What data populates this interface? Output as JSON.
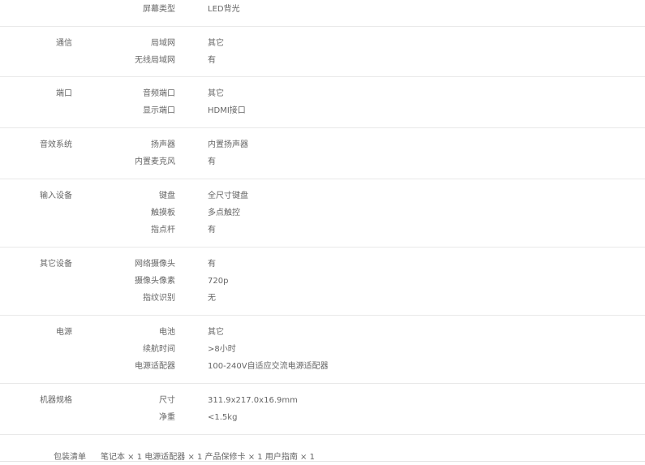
{
  "groups": [
    {
      "label": "",
      "rows": [
        {
          "k": "屏幕类型",
          "v": "LED背光"
        }
      ]
    },
    {
      "label": "通信",
      "rows": [
        {
          "k": "局域网",
          "v": "其它"
        },
        {
          "k": "无线局域网",
          "v": "有"
        }
      ]
    },
    {
      "label": "端口",
      "rows": [
        {
          "k": "音频端口",
          "v": "其它"
        },
        {
          "k": "显示端口",
          "v": "HDMI接口"
        }
      ]
    },
    {
      "label": "音效系统",
      "rows": [
        {
          "k": "扬声器",
          "v": "内置扬声器"
        },
        {
          "k": "内置麦克风",
          "v": "有"
        }
      ]
    },
    {
      "label": "输入设备",
      "rows": [
        {
          "k": "键盘",
          "v": "全尺寸键盘"
        },
        {
          "k": "触摸板",
          "v": "多点触控"
        },
        {
          "k": "指点杆",
          "v": "有"
        }
      ]
    },
    {
      "label": "其它设备",
      "rows": [
        {
          "k": "网络摄像头",
          "v": "有"
        },
        {
          "k": "摄像头像素",
          "v": "720p"
        },
        {
          "k": "指纹识别",
          "v": "无"
        }
      ]
    },
    {
      "label": "电源",
      "rows": [
        {
          "k": "电池",
          "v": "其它"
        },
        {
          "k": "续航时间",
          "v": ">8小时"
        },
        {
          "k": "电源适配器",
          "v": "100-240V自适应交流电源适配器"
        }
      ]
    },
    {
      "label": "机器规格",
      "rows": [
        {
          "k": "尺寸",
          "v": "311.9x217.0x16.9mm"
        },
        {
          "k": "净重",
          "v": "<1.5kg"
        }
      ]
    }
  ],
  "package": {
    "label": "包装清单",
    "value": "笔记本 × 1 电源适配器 × 1 产品保修卡 × 1 用户指南 × 1"
  }
}
